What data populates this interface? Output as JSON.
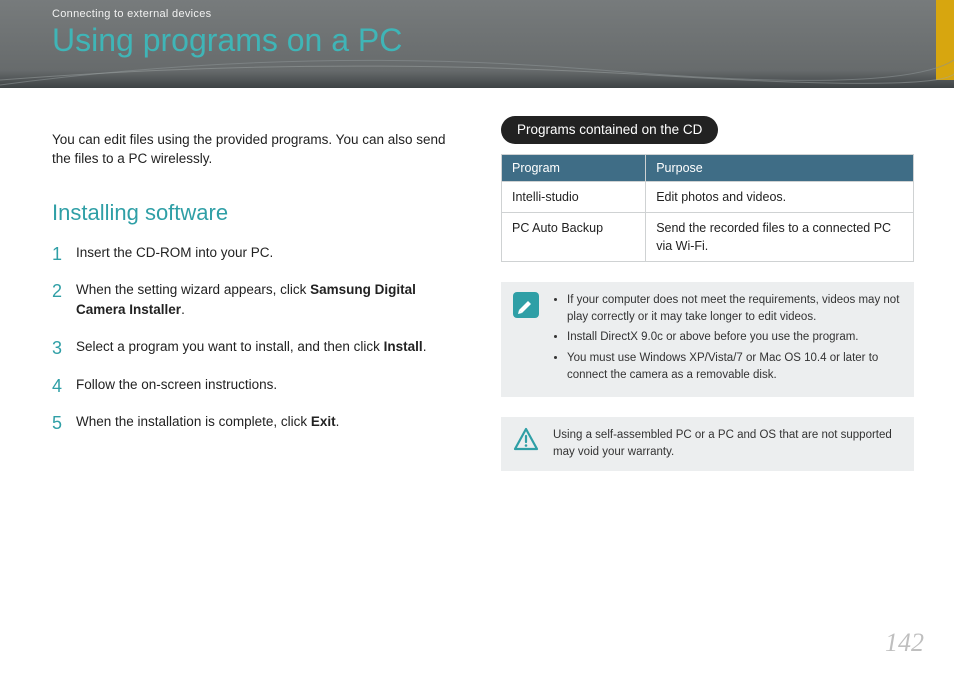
{
  "header": {
    "breadcrumb": "Connecting to external devices",
    "title": "Using programs on a PC"
  },
  "left": {
    "intro": "You can edit files using the provided programs. You can also send the files to a PC wirelessly.",
    "section_heading": "Installing software",
    "steps": [
      {
        "text": "Insert the CD-ROM into your PC."
      },
      {
        "prefix": "When the setting wizard appears, click ",
        "bold": "Samsung Digital Camera Installer",
        "suffix": "."
      },
      {
        "prefix": "Select a program you want to install, and then click ",
        "bold": "Install",
        "suffix": "."
      },
      {
        "text": "Follow the on-screen instructions."
      },
      {
        "prefix": "When the installation is complete, click ",
        "bold": "Exit",
        "suffix": "."
      }
    ]
  },
  "right": {
    "pill": "Programs contained on the CD",
    "table": {
      "headers": [
        "Program",
        "Purpose"
      ],
      "rows": [
        [
          "Intelli-studio",
          "Edit photos and videos."
        ],
        [
          "PC Auto Backup",
          "Send the recorded files to a connected PC via Wi-Fi."
        ]
      ]
    },
    "note_items": [
      "If your computer does not meet the requirements, videos may not play correctly or it may take longer to edit videos.",
      "Install DirectX 9.0c or above before you use the program.",
      "You must use Windows XP/Vista/7 or Mac OS 10.4 or later to connect the camera as a removable disk."
    ],
    "warning": "Using a self-assembled PC or a PC and OS that are not supported may void your warranty."
  },
  "page_number": "142"
}
